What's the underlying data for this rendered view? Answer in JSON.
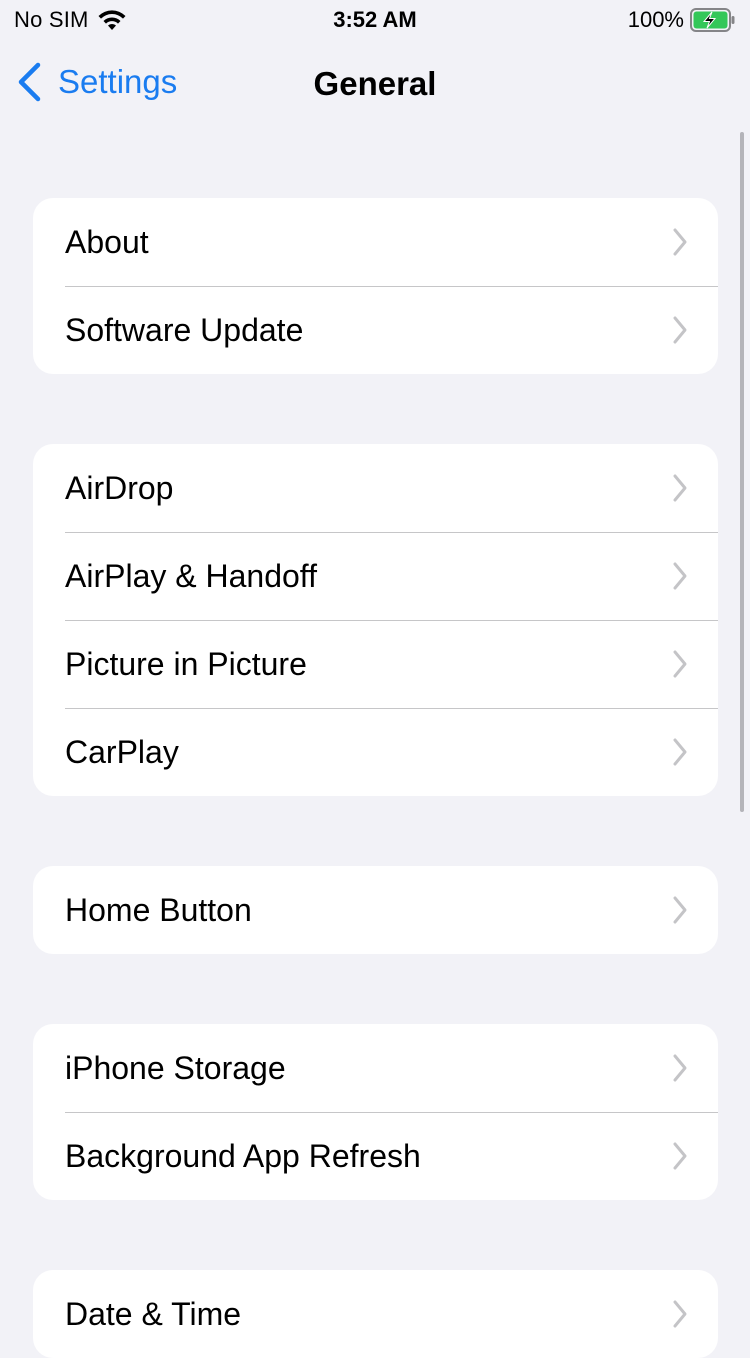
{
  "status_bar": {
    "carrier": "No SIM",
    "time": "3:52 AM",
    "battery_percent": "100%",
    "battery_level": 1.0,
    "battery_color": "#34c759"
  },
  "nav": {
    "back_label": "Settings",
    "title": "General",
    "accent_color": "#1a7cf0"
  },
  "groups": [
    {
      "items": [
        {
          "label": "About"
        },
        {
          "label": "Software Update"
        }
      ]
    },
    {
      "items": [
        {
          "label": "AirDrop"
        },
        {
          "label": "AirPlay & Handoff"
        },
        {
          "label": "Picture in Picture"
        },
        {
          "label": "CarPlay"
        }
      ]
    },
    {
      "items": [
        {
          "label": "Home Button"
        }
      ]
    },
    {
      "items": [
        {
          "label": "iPhone Storage"
        },
        {
          "label": "Background App Refresh"
        }
      ]
    },
    {
      "items": [
        {
          "label": "Date & Time"
        }
      ]
    }
  ]
}
